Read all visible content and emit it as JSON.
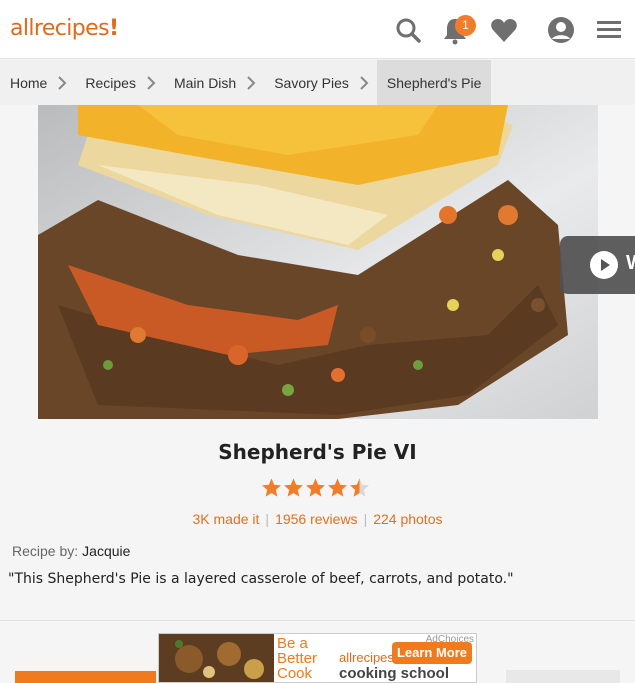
{
  "header": {
    "logo_text": "allrecipes",
    "logo_bang": "!",
    "notification_count": "1",
    "icons": [
      "search-icon",
      "bell-icon",
      "heart-icon",
      "user-icon",
      "menu-icon"
    ]
  },
  "breadcrumb": [
    {
      "label": "Home"
    },
    {
      "label": "Recipes"
    },
    {
      "label": "Main Dish"
    },
    {
      "label": "Savory Pies"
    },
    {
      "label": "Shepherd's Pie"
    }
  ],
  "video": {
    "label": "W"
  },
  "recipe": {
    "title": "Shepherd's Pie VI",
    "rating": 4.5,
    "made_it": "3K made it",
    "reviews": "1956 reviews",
    "photos": "224 photos",
    "recipe_by_label": "Recipe by:",
    "author": "Jacquie",
    "description": "\"This Shepherd's Pie is a layered casserole of beef, carrots, and potato.\""
  },
  "ad": {
    "line1": "Be a",
    "line2": "Better",
    "line3": "Cook",
    "brand": "allrecipes!",
    "school": "cooking school",
    "cta": "Learn More",
    "choices": "AdChoices"
  },
  "colors": {
    "accent": "#f37c2a",
    "header_bg": "#ffffff",
    "page_bg": "#f5f5f5"
  }
}
